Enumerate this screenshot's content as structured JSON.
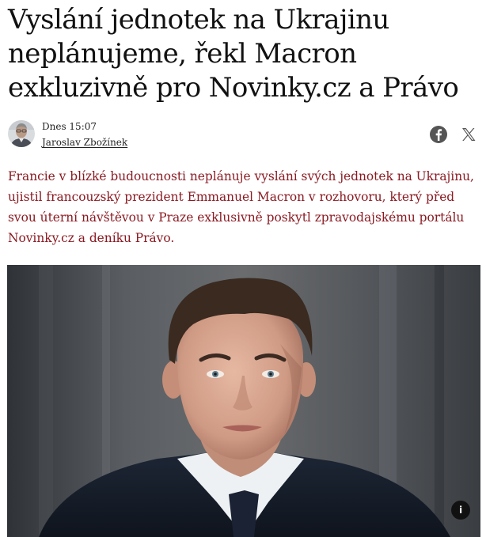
{
  "article": {
    "headline": "Vyslání jednotek na Ukrajinu neplánujeme, řekl Macron exkluzivně pro Novinky.cz a Právo",
    "date": "Dnes 15:07",
    "author": "Jaroslav Zbožínek",
    "perex": "Francie v blízké budoucnosti neplánuje vyslání svých jednotek na Ukrajinu, ujistil francouzský prezident Emmanuel Macron v rozhovoru, který před svou úterní návštěvou v Praze exklusivně poskytl zpravodajskému portálu Novinky.cz a deníku Právo.",
    "info_label": "i"
  },
  "share": {
    "icons": [
      "facebook-icon",
      "x-icon"
    ]
  },
  "colors": {
    "perex": "#8a1a22",
    "headline": "#111111",
    "share_icon": "#555555"
  }
}
